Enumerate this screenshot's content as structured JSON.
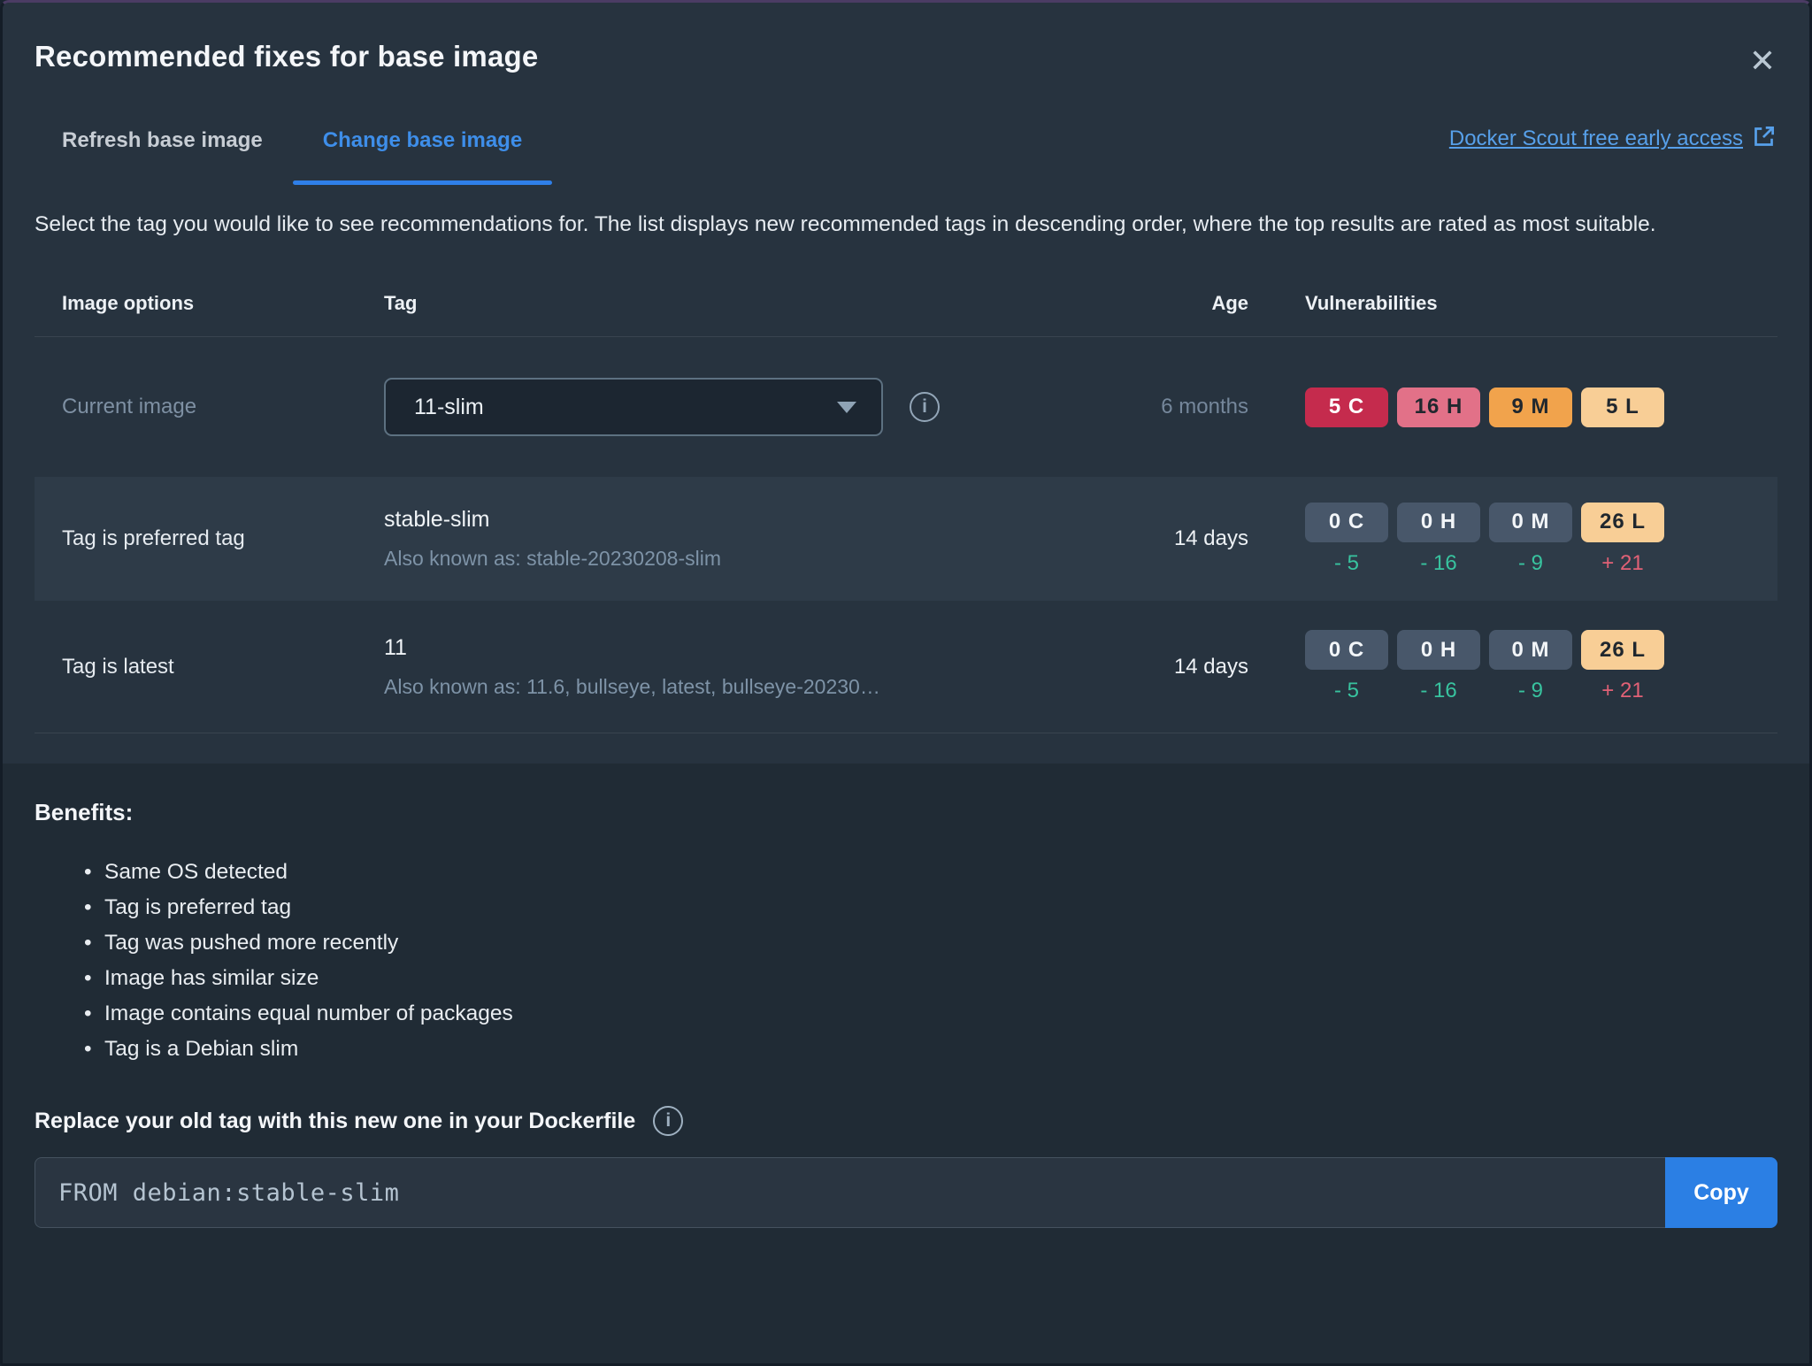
{
  "modal": {
    "title": "Recommended fixes for base image"
  },
  "tabs": {
    "refresh": "Refresh base image",
    "change": "Change base image"
  },
  "scout_link": {
    "label": "Docker Scout free early access"
  },
  "description": "Select the tag you would like to see recommendations for. The list displays new recommended tags in descending order, where the top results are rated as most suitable.",
  "table": {
    "headers": {
      "image_options": "Image options",
      "tag": "Tag",
      "age": "Age",
      "vulnerabilities": "Vulnerabilities"
    },
    "rows": [
      {
        "option": "Current image",
        "tag_value": "11-slim",
        "age": "6 months",
        "badges": [
          {
            "label": "5 C",
            "severity": "critical"
          },
          {
            "label": "16 H",
            "severity": "high"
          },
          {
            "label": "9 M",
            "severity": "medium"
          },
          {
            "label": "5 L",
            "severity": "low"
          }
        ]
      },
      {
        "option": "Tag is preferred tag",
        "tag": "stable-slim",
        "aka": "Also known as: stable-20230208-slim",
        "age": "14 days",
        "badges": [
          {
            "label": "0 C",
            "severity": "zero"
          },
          {
            "label": "0 H",
            "severity": "zero"
          },
          {
            "label": "0 M",
            "severity": "zero"
          },
          {
            "label": "26 L",
            "severity": "low"
          }
        ],
        "deltas": [
          "- 5",
          "- 16",
          "- 9",
          "+ 21"
        ]
      },
      {
        "option": "Tag is latest",
        "tag": "11",
        "aka": "Also known as: 11.6, bullseye, latest, bullseye-20230…",
        "age": "14 days",
        "badges": [
          {
            "label": "0 C",
            "severity": "zero"
          },
          {
            "label": "0 H",
            "severity": "zero"
          },
          {
            "label": "0 M",
            "severity": "zero"
          },
          {
            "label": "26 L",
            "severity": "low"
          }
        ],
        "deltas": [
          "- 5",
          "- 16",
          "- 9",
          "+ 21"
        ]
      }
    ]
  },
  "benefits": {
    "heading": "Benefits:",
    "items": [
      "Same OS detected",
      "Tag is preferred tag",
      "Tag was pushed more recently",
      "Image has similar size",
      "Image contains equal number of packages",
      "Tag is a Debian slim"
    ]
  },
  "dockerfile": {
    "heading": "Replace your old tag with this new one in your Dockerfile",
    "code": "FROM debian:stable-slim",
    "copy_label": "Copy"
  },
  "icons": {
    "close": "✕",
    "info": "i"
  },
  "colors": {
    "accent_blue": "#2F7FE8",
    "link_blue": "#57A0EA",
    "critical": "#C52B4D",
    "high": "#E27188",
    "medium": "#F1A34C",
    "low": "#F8CE96",
    "neutral_badge": "#48576A",
    "delta_decrease": "#38C39F",
    "delta_increase": "#E26176",
    "surface_top": "#27333F",
    "surface_bottom": "#202B35",
    "row_highlight": "#2E3B48"
  }
}
